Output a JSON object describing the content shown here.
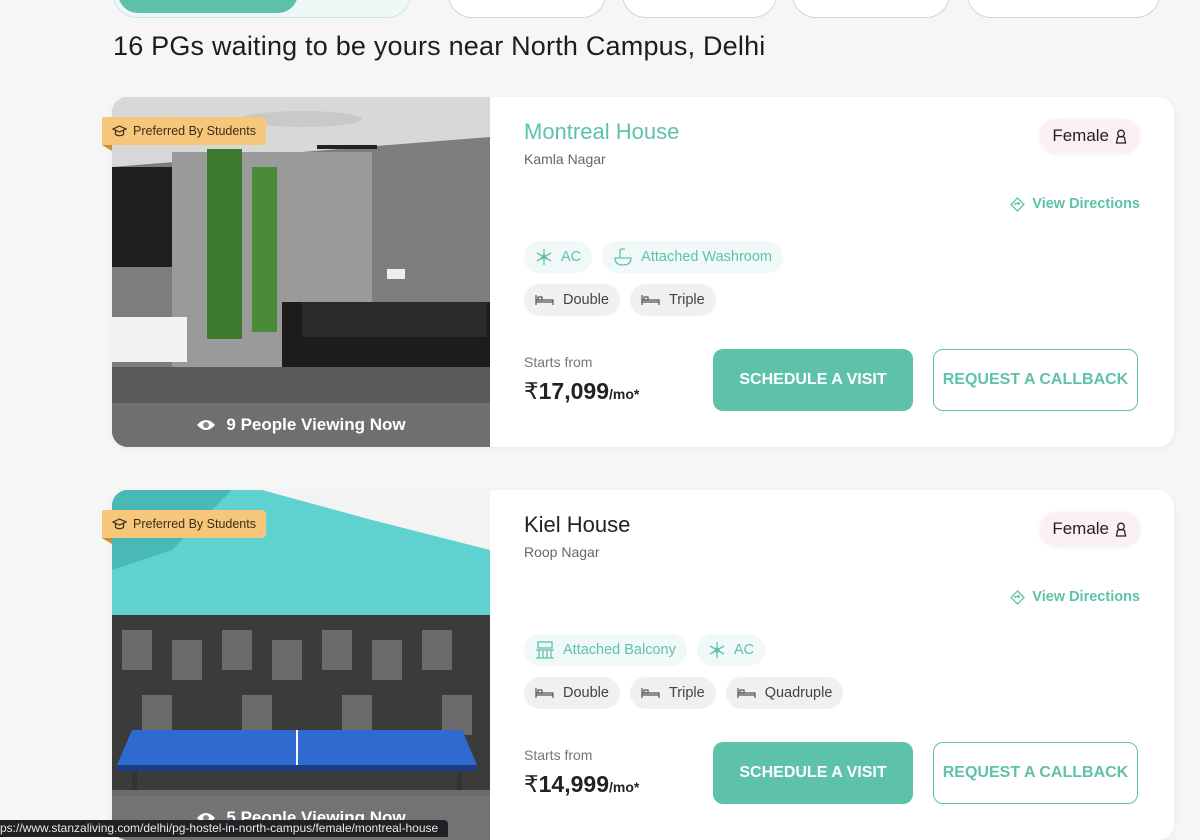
{
  "heading": "16 PGs waiting to be yours near North Campus, Delhi",
  "colors": {
    "accent": "#5ec2ab",
    "preferred_badge": "#f6c67a",
    "gender_bg": "#fdf0f3"
  },
  "listings": [
    {
      "name": "Montreal House",
      "locality": "Kamla Nagar",
      "gender": "Female",
      "preferred_badge": "Preferred By Students",
      "viewing": "9 People Viewing Now",
      "directions": "View Directions",
      "amenities": [
        "AC",
        "Attached Washroom"
      ],
      "rooms": [
        "Double",
        "Triple"
      ],
      "starts_from": "Starts from",
      "price_symbol": "₹",
      "price": "17,099",
      "price_unit": "/mo*",
      "schedule": "SCHEDULE A VISIT",
      "callback": "REQUEST A CALLBACK"
    },
    {
      "name": "Kiel House",
      "locality": "Roop Nagar",
      "gender": "Female",
      "preferred_badge": "Preferred By Students",
      "viewing": "5 People Viewing Now",
      "directions": "View Directions",
      "amenities": [
        "Attached Balcony",
        "AC"
      ],
      "rooms": [
        "Double",
        "Triple",
        "Quadruple"
      ],
      "starts_from": "Starts from",
      "price_symbol": "₹",
      "price": "14,999",
      "price_unit": "/mo*",
      "schedule": "SCHEDULE A VISIT",
      "callback": "REQUEST A CALLBACK"
    }
  ],
  "status_url": "ps://www.stanzaliving.com/delhi/pg-hostel-in-north-campus/female/montreal-house"
}
